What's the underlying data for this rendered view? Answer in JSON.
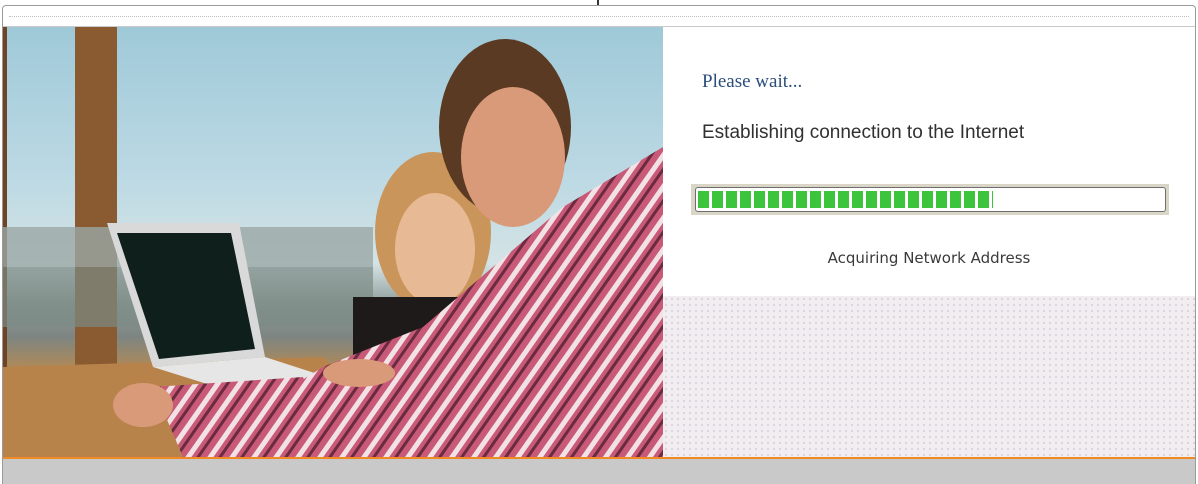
{
  "status": {
    "wait_text": "Please wait...",
    "message": "Establishing connection to the Internet",
    "stage_text": "Acquiring Network Address"
  },
  "progress": {
    "percent": 63,
    "fill_color": "#3cc43c"
  },
  "colors": {
    "accent": "#f08a24",
    "footer": "#c9c9c9",
    "wait_text": "#2a4d7a"
  },
  "photo": {
    "subject": "two people at a laptop by a window"
  }
}
